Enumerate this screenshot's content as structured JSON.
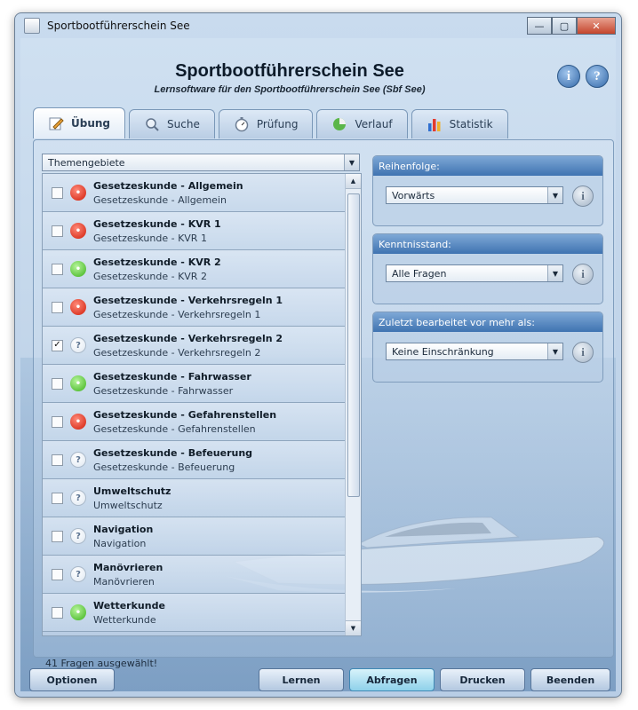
{
  "window": {
    "title": "Sportbootführerschein See"
  },
  "header": {
    "title": "Sportbootführerschein See",
    "subtitle": "Lernsoftware für den Sportbootführerschein See (Sbf See)"
  },
  "tabs": [
    {
      "label": "Übung",
      "active": true
    },
    {
      "label": "Suche"
    },
    {
      "label": "Prüfung"
    },
    {
      "label": "Verlauf"
    },
    {
      "label": "Statistik"
    }
  ],
  "topics_combo": {
    "value": "Themengebiete"
  },
  "topics": [
    {
      "title": "Gesetzeskunde - Allgemein",
      "subtitle": "Gesetzeskunde - Allgemein",
      "checked": false,
      "status": "red"
    },
    {
      "title": "Gesetzeskunde - KVR 1",
      "subtitle": "Gesetzeskunde - KVR 1",
      "checked": false,
      "status": "red"
    },
    {
      "title": "Gesetzeskunde - KVR 2",
      "subtitle": "Gesetzeskunde - KVR 2",
      "checked": false,
      "status": "green"
    },
    {
      "title": "Gesetzeskunde - Verkehrsregeln 1",
      "subtitle": "Gesetzeskunde - Verkehrsregeln 1",
      "checked": false,
      "status": "red"
    },
    {
      "title": "Gesetzeskunde - Verkehrsregeln 2",
      "subtitle": "Gesetzeskunde - Verkehrsregeln 2",
      "checked": true,
      "status": "unknown"
    },
    {
      "title": "Gesetzeskunde - Fahrwasser",
      "subtitle": "Gesetzeskunde - Fahrwasser",
      "checked": false,
      "status": "green"
    },
    {
      "title": "Gesetzeskunde - Gefahrenstellen",
      "subtitle": "Gesetzeskunde - Gefahrenstellen",
      "checked": false,
      "status": "red"
    },
    {
      "title": "Gesetzeskunde - Befeuerung",
      "subtitle": "Gesetzeskunde - Befeuerung",
      "checked": false,
      "status": "unknown"
    },
    {
      "title": "Umweltschutz",
      "subtitle": "Umweltschutz",
      "checked": false,
      "status": "unknown"
    },
    {
      "title": "Navigation",
      "subtitle": "Navigation",
      "checked": false,
      "status": "unknown"
    },
    {
      "title": "Manövrieren",
      "subtitle": "Manövrieren",
      "checked": false,
      "status": "unknown"
    },
    {
      "title": "Wetterkunde",
      "subtitle": "Wetterkunde",
      "checked": false,
      "status": "green"
    }
  ],
  "selection_count": "41 Fragen ausgewählt!",
  "order": {
    "label": "Reihenfolge:",
    "value": "Vorwärts"
  },
  "knowledge": {
    "label": "Kenntnisstand:",
    "value": "Alle Fragen"
  },
  "last_edited": {
    "label": "Zuletzt bearbeitet vor mehr als:",
    "value": "Keine Einschränkung"
  },
  "buttons": {
    "options": "Optionen",
    "learn": "Lernen",
    "query": "Abfragen",
    "print": "Drucken",
    "exit": "Beenden"
  },
  "colors": {
    "status_red": "#d01c08",
    "status_green": "#3cb11a",
    "accent": "#3f73b1"
  },
  "icons": {
    "tab_uebung": "pencil-paper-icon",
    "tab_suche": "magnifier-icon",
    "tab_pruefung": "stopwatch-icon",
    "tab_verlauf": "pie-chart-icon",
    "tab_statistik": "bar-chart-icon",
    "unknown_status": "question-bubble-icon"
  }
}
